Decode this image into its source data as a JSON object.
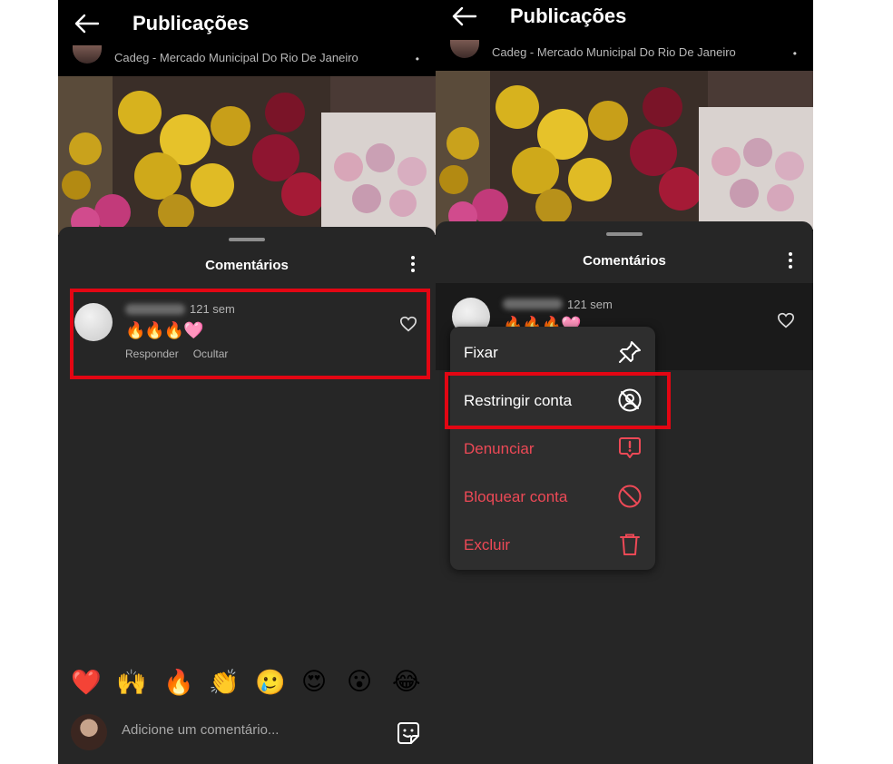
{
  "header": {
    "title": "Publicações",
    "location": "Cadeg - Mercado Municipal Do Rio De Janeiro",
    "more": "•"
  },
  "comments_sheet": {
    "title": "Comentários"
  },
  "comment": {
    "time": "121 sem",
    "emojis": "🔥🔥🔥🩷",
    "reply_label": "Responder",
    "hide_label": "Ocultar"
  },
  "reactions": [
    "❤️",
    "🙌",
    "🔥",
    "👏",
    "🥲",
    "😍",
    "😮",
    "😂"
  ],
  "composer": {
    "placeholder": "Adicione um comentário..."
  },
  "context_menu": {
    "items": [
      {
        "label": "Fixar",
        "icon": "pin-icon",
        "danger": false
      },
      {
        "label": "Restringir conta",
        "icon": "restrict-icon",
        "danger": false
      },
      {
        "label": "Denunciar",
        "icon": "report-icon",
        "danger": true
      },
      {
        "label": "Bloquear conta",
        "icon": "block-icon",
        "danger": true
      },
      {
        "label": "Excluir",
        "icon": "trash-icon",
        "danger": true
      }
    ]
  },
  "colors": {
    "highlight_box": "#e30613",
    "danger_text": "#ed4956",
    "sheet_bg": "#262626"
  }
}
